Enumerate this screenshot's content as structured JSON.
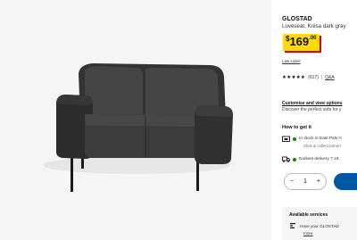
{
  "product": {
    "name": "GLOSTAD",
    "description": "Loveseat, Knisa dark gray",
    "price_currency": "$",
    "price_integer": "169",
    "price_decimals": ".00",
    "law_label": "Law Label"
  },
  "rating": {
    "stars_text": "★★★★★",
    "value": 4.5,
    "count": "(617)",
    "separator": "|",
    "qa_label": "Q&A"
  },
  "customise": {
    "title": "Customise and view options",
    "subtitle": "Discover the perfect sofa for y"
  },
  "delivery": {
    "heading": "How to get it",
    "store_status": "In stock in East Palo A",
    "store_sub": "Click & collect tomorr",
    "delivery_text": "Earliest delivery 7.24."
  },
  "cart": {
    "quantity": "1",
    "minus": "−",
    "plus": "+"
  },
  "services": {
    "title": "Available services",
    "text": "Have your GLOSTAD",
    "more": "more"
  },
  "colors": {
    "price_bg": "#ffdb00",
    "price_shadow": "#cc0008",
    "stock_green": "#0a8a00",
    "brand_blue": "#0058a3",
    "sofa": "#3a3a3a"
  }
}
